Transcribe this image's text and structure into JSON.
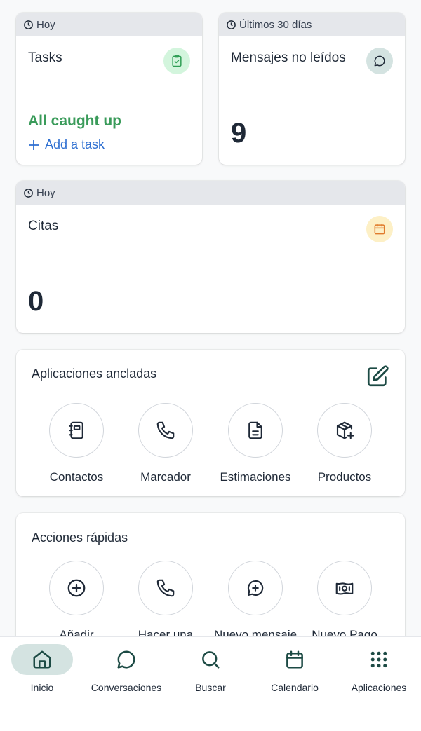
{
  "tasks_card": {
    "header": "Hoy",
    "title": "Tasks",
    "status": "All caught up",
    "add_label": "Add a task"
  },
  "messages_card": {
    "header": "Últimos 30 días",
    "title": "Mensajes no leídos",
    "count": "9"
  },
  "appointments_card": {
    "header": "Hoy",
    "title": "Citas",
    "count": "0"
  },
  "pinned_apps": {
    "title": "Aplicaciones ancladas",
    "items": [
      {
        "label": "Contactos",
        "icon": "contacts-book-icon"
      },
      {
        "label": "Marcador",
        "icon": "phone-icon"
      },
      {
        "label": "Estimaciones",
        "icon": "document-icon"
      },
      {
        "label": "Productos",
        "icon": "package-plus-icon"
      }
    ]
  },
  "quick_actions": {
    "title": "Acciones rápidas",
    "items": [
      {
        "label": "Añadir",
        "icon": "plus-circle-icon"
      },
      {
        "label": "Hacer una",
        "icon": "phone-icon"
      },
      {
        "label": "Nuevo mensaje",
        "icon": "message-plus-icon"
      },
      {
        "label": "Nuevo Pago",
        "icon": "banknote-icon"
      }
    ]
  },
  "bottom_nav": {
    "items": [
      {
        "label": "Inicio",
        "icon": "home-icon",
        "active": true
      },
      {
        "label": "Conversaciones",
        "icon": "chat-bubble-icon",
        "active": false
      },
      {
        "label": "Buscar",
        "icon": "search-icon",
        "active": false
      },
      {
        "label": "Calendario",
        "icon": "calendar-icon",
        "active": false
      },
      {
        "label": "Aplicaciones",
        "icon": "grid-icon",
        "active": false
      }
    ]
  },
  "colors": {
    "accent_green": "#3a9b5a",
    "link_blue": "#2e6fd1",
    "nav_active_bg": "#d4e3e1",
    "card_header_bg": "#e5e7eb"
  }
}
